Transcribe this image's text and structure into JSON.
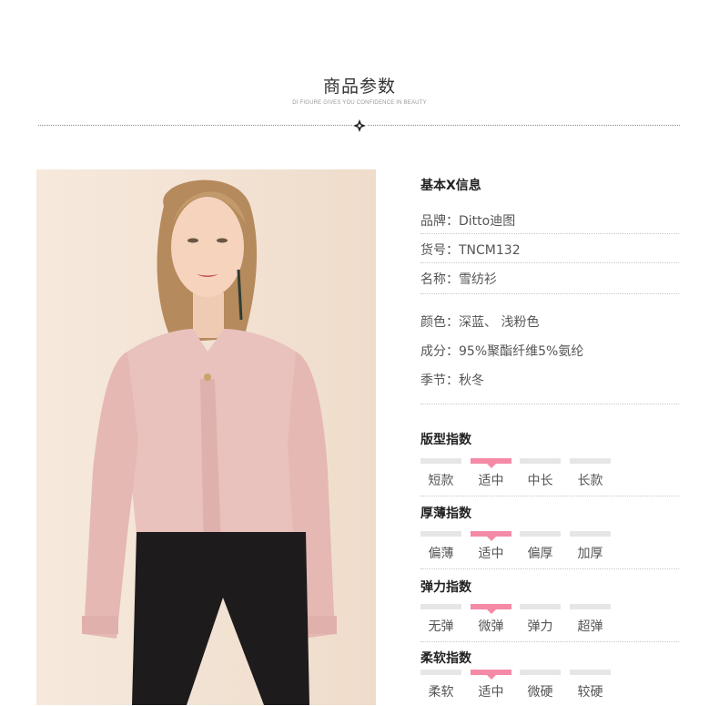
{
  "header": {
    "title": "商品参数",
    "subtitle": "DI FIGURE GIVES YOU CONFIDENCE IN BEAUTY"
  },
  "basic_info": {
    "title": "基本X信息",
    "brand": "品牌：Ditto迪图",
    "item_no": "货号：TNCM132",
    "name": "名称：雪纺衫",
    "color": "颜色：深蓝、 浅粉色",
    "composition": "成分：95%聚酯纤维5%氨纶",
    "season": "季节：秋冬"
  },
  "indices": [
    {
      "title": "版型指数",
      "options": [
        "短款",
        "适中",
        "中长",
        "长款"
      ],
      "selected": "适中"
    },
    {
      "title": "厚薄指数",
      "options": [
        "偏薄",
        "适中",
        "偏厚",
        "加厚"
      ],
      "selected": "适中"
    },
    {
      "title": "弹力指数",
      "options": [
        "无弹",
        "微弹",
        "弹力",
        "超弹"
      ],
      "selected": "微弹"
    },
    {
      "title": "柔软指数",
      "options": [
        "柔软",
        "适中",
        "微硬",
        "较硬"
      ],
      "selected": "适中"
    }
  ],
  "colors": {
    "accent": "#f48aa6",
    "inactive_bar": "#e6e6e6",
    "photo_bg": "#f3e4d6",
    "blouse": "#e9c1bd",
    "pants": "#1e1b1d"
  }
}
